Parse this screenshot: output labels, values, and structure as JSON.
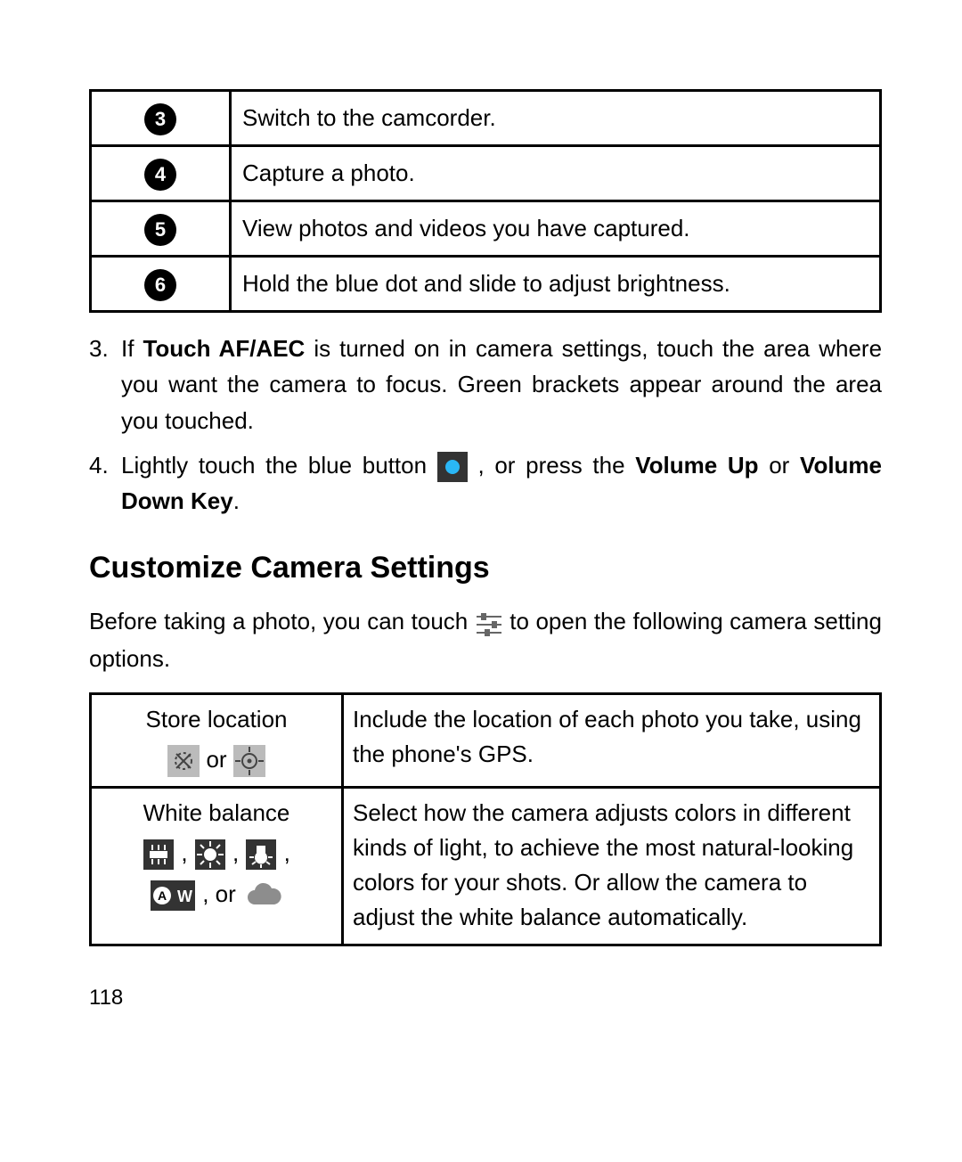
{
  "top_table": {
    "rows": [
      {
        "num": "3",
        "text": "Switch to the camcorder."
      },
      {
        "num": "4",
        "text": "Capture a photo."
      },
      {
        "num": "5",
        "text": "View photos and videos you have captured."
      },
      {
        "num": "6",
        "text": "Hold the blue dot and slide to adjust brightness."
      }
    ]
  },
  "step3": {
    "idx": "3.",
    "text_before": "If ",
    "bold": "Touch AF/AEC",
    "text_after": " is turned on in camera settings, touch the area where you want the camera to focus. Green brackets appear around the area you touched."
  },
  "step4": {
    "idx": "4.",
    "text_before": "Lightly touch the blue button ",
    "text_mid": " , or press the ",
    "bold1": "Volume Up",
    "text_mid2": " or ",
    "bold2": "Volume Down Key",
    "text_end": "."
  },
  "heading": "Customize Camera Settings",
  "para": {
    "before": "Before taking a photo, you can touch ",
    "after": " to open the following camera setting options."
  },
  "settings": {
    "row1": {
      "left_title": "Store location",
      "left_or": " or ",
      "right": "Include the location of each photo you take, using the phone's GPS."
    },
    "row2": {
      "left_title": "White balance",
      "left_or": " , or ",
      "right": "Select how the camera adjusts colors in different kinds of light, to achieve the most natural-looking colors for your shots. Or allow the camera to adjust the white balance automatically."
    }
  },
  "page_number": "118"
}
